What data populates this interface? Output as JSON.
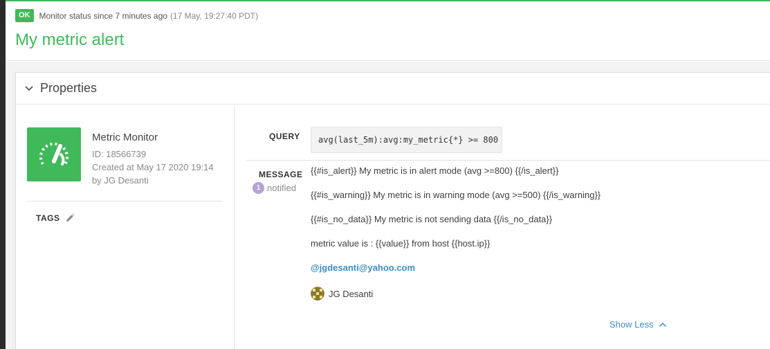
{
  "status": {
    "badge": "OK",
    "text": "Monitor status since 7 minutes ago",
    "timestamp": "(17 May, 19:27:40 PDT)",
    "color": "#3fb95a"
  },
  "monitor": {
    "title": "My metric alert",
    "type": "Metric Monitor",
    "id": "ID: 18566739",
    "created": "Created at May 17 2020 19:14",
    "author": "by JG Desanti",
    "icon": "speedometer-icon"
  },
  "properties": {
    "title": "Properties",
    "tags_label": "TAGS",
    "query_label": "QUERY",
    "query": "avg(last_5m):avg:my_metric{*} >= 800",
    "message_label": "MESSAGE",
    "notified_count": "1",
    "notified_text": "notified"
  },
  "message": {
    "lines": [
      "{{#is_alert}} My metric is in alert mode (avg >=800) {{/is_alert}}",
      "{{#is_warning}} My metric is in warning mode (avg >=500) {{/is_warning}}",
      "{{#is_no_data}} My metric is not sending data {{/is_no_data}}",
      "metric value is : {{value}} from host {{host.ip}}"
    ],
    "mention": "@jgdesanti@yahoo.com",
    "user_name": "JG Desanti"
  },
  "footer": {
    "show_less": "Show Less"
  },
  "colors": {
    "accent_green": "#3fb95a",
    "link_blue": "#3a8cc7",
    "badge_purple": "#b8a0d8"
  }
}
